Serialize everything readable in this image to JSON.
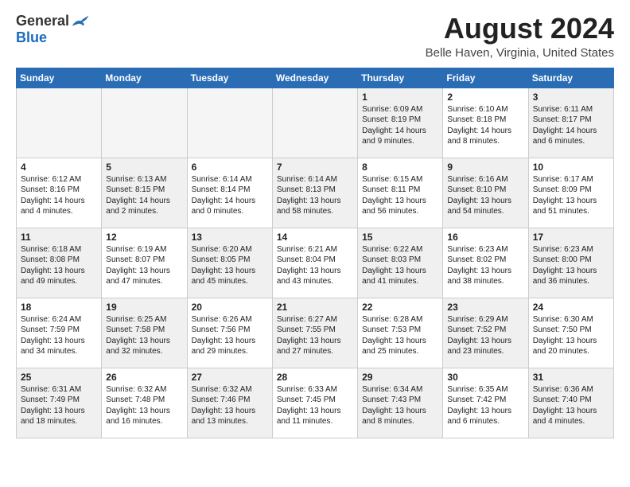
{
  "header": {
    "logo_general": "General",
    "logo_blue": "Blue",
    "month_title": "August 2024",
    "location": "Belle Haven, Virginia, United States"
  },
  "days_of_week": [
    "Sunday",
    "Monday",
    "Tuesday",
    "Wednesday",
    "Thursday",
    "Friday",
    "Saturday"
  ],
  "weeks": [
    [
      {
        "day": "",
        "info": "",
        "empty": true
      },
      {
        "day": "",
        "info": "",
        "empty": true
      },
      {
        "day": "",
        "info": "",
        "empty": true
      },
      {
        "day": "",
        "info": "",
        "empty": true
      },
      {
        "day": "1",
        "info": "Sunrise: 6:09 AM\nSunset: 8:19 PM\nDaylight: 14 hours\nand 9 minutes.",
        "empty": false
      },
      {
        "day": "2",
        "info": "Sunrise: 6:10 AM\nSunset: 8:18 PM\nDaylight: 14 hours\nand 8 minutes.",
        "empty": false
      },
      {
        "day": "3",
        "info": "Sunrise: 6:11 AM\nSunset: 8:17 PM\nDaylight: 14 hours\nand 6 minutes.",
        "empty": false
      }
    ],
    [
      {
        "day": "4",
        "info": "Sunrise: 6:12 AM\nSunset: 8:16 PM\nDaylight: 14 hours\nand 4 minutes.",
        "empty": false
      },
      {
        "day": "5",
        "info": "Sunrise: 6:13 AM\nSunset: 8:15 PM\nDaylight: 14 hours\nand 2 minutes.",
        "empty": false
      },
      {
        "day": "6",
        "info": "Sunrise: 6:14 AM\nSunset: 8:14 PM\nDaylight: 14 hours\nand 0 minutes.",
        "empty": false
      },
      {
        "day": "7",
        "info": "Sunrise: 6:14 AM\nSunset: 8:13 PM\nDaylight: 13 hours\nand 58 minutes.",
        "empty": false
      },
      {
        "day": "8",
        "info": "Sunrise: 6:15 AM\nSunset: 8:11 PM\nDaylight: 13 hours\nand 56 minutes.",
        "empty": false
      },
      {
        "day": "9",
        "info": "Sunrise: 6:16 AM\nSunset: 8:10 PM\nDaylight: 13 hours\nand 54 minutes.",
        "empty": false
      },
      {
        "day": "10",
        "info": "Sunrise: 6:17 AM\nSunset: 8:09 PM\nDaylight: 13 hours\nand 51 minutes.",
        "empty": false
      }
    ],
    [
      {
        "day": "11",
        "info": "Sunrise: 6:18 AM\nSunset: 8:08 PM\nDaylight: 13 hours\nand 49 minutes.",
        "empty": false
      },
      {
        "day": "12",
        "info": "Sunrise: 6:19 AM\nSunset: 8:07 PM\nDaylight: 13 hours\nand 47 minutes.",
        "empty": false
      },
      {
        "day": "13",
        "info": "Sunrise: 6:20 AM\nSunset: 8:05 PM\nDaylight: 13 hours\nand 45 minutes.",
        "empty": false
      },
      {
        "day": "14",
        "info": "Sunrise: 6:21 AM\nSunset: 8:04 PM\nDaylight: 13 hours\nand 43 minutes.",
        "empty": false
      },
      {
        "day": "15",
        "info": "Sunrise: 6:22 AM\nSunset: 8:03 PM\nDaylight: 13 hours\nand 41 minutes.",
        "empty": false
      },
      {
        "day": "16",
        "info": "Sunrise: 6:23 AM\nSunset: 8:02 PM\nDaylight: 13 hours\nand 38 minutes.",
        "empty": false
      },
      {
        "day": "17",
        "info": "Sunrise: 6:23 AM\nSunset: 8:00 PM\nDaylight: 13 hours\nand 36 minutes.",
        "empty": false
      }
    ],
    [
      {
        "day": "18",
        "info": "Sunrise: 6:24 AM\nSunset: 7:59 PM\nDaylight: 13 hours\nand 34 minutes.",
        "empty": false
      },
      {
        "day": "19",
        "info": "Sunrise: 6:25 AM\nSunset: 7:58 PM\nDaylight: 13 hours\nand 32 minutes.",
        "empty": false
      },
      {
        "day": "20",
        "info": "Sunrise: 6:26 AM\nSunset: 7:56 PM\nDaylight: 13 hours\nand 29 minutes.",
        "empty": false
      },
      {
        "day": "21",
        "info": "Sunrise: 6:27 AM\nSunset: 7:55 PM\nDaylight: 13 hours\nand 27 minutes.",
        "empty": false
      },
      {
        "day": "22",
        "info": "Sunrise: 6:28 AM\nSunset: 7:53 PM\nDaylight: 13 hours\nand 25 minutes.",
        "empty": false
      },
      {
        "day": "23",
        "info": "Sunrise: 6:29 AM\nSunset: 7:52 PM\nDaylight: 13 hours\nand 23 minutes.",
        "empty": false
      },
      {
        "day": "24",
        "info": "Sunrise: 6:30 AM\nSunset: 7:50 PM\nDaylight: 13 hours\nand 20 minutes.",
        "empty": false
      }
    ],
    [
      {
        "day": "25",
        "info": "Sunrise: 6:31 AM\nSunset: 7:49 PM\nDaylight: 13 hours\nand 18 minutes.",
        "empty": false
      },
      {
        "day": "26",
        "info": "Sunrise: 6:32 AM\nSunset: 7:48 PM\nDaylight: 13 hours\nand 16 minutes.",
        "empty": false
      },
      {
        "day": "27",
        "info": "Sunrise: 6:32 AM\nSunset: 7:46 PM\nDaylight: 13 hours\nand 13 minutes.",
        "empty": false
      },
      {
        "day": "28",
        "info": "Sunrise: 6:33 AM\nSunset: 7:45 PM\nDaylight: 13 hours\nand 11 minutes.",
        "empty": false
      },
      {
        "day": "29",
        "info": "Sunrise: 6:34 AM\nSunset: 7:43 PM\nDaylight: 13 hours\nand 8 minutes.",
        "empty": false
      },
      {
        "day": "30",
        "info": "Sunrise: 6:35 AM\nSunset: 7:42 PM\nDaylight: 13 hours\nand 6 minutes.",
        "empty": false
      },
      {
        "day": "31",
        "info": "Sunrise: 6:36 AM\nSunset: 7:40 PM\nDaylight: 13 hours\nand 4 minutes.",
        "empty": false
      }
    ]
  ]
}
